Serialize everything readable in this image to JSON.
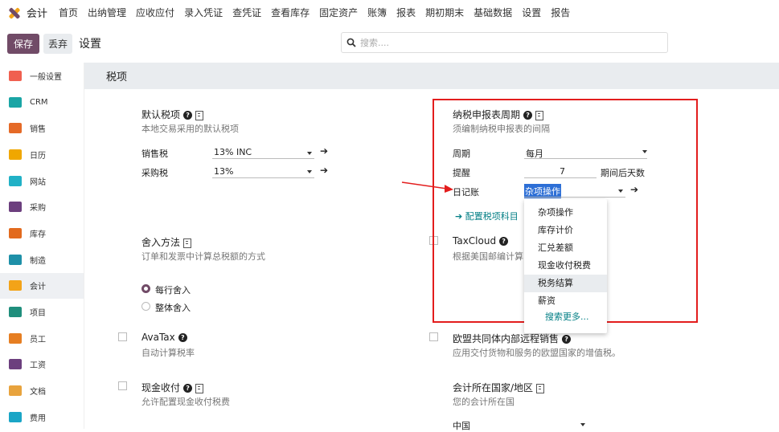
{
  "topnav": {
    "app_name": "会计",
    "menu": [
      "首页",
      "出纳管理",
      "应收应付",
      "录入凭证",
      "查凭证",
      "查看库存",
      "固定资产",
      "账簿",
      "报表",
      "期初期末",
      "基础数据",
      "设置",
      "报告"
    ]
  },
  "controlpanel": {
    "save_label": "保存",
    "discard_label": "丢弃",
    "title": "设置",
    "search_placeholder": "搜索...."
  },
  "sidebar": {
    "items": [
      {
        "label": "一般设置",
        "icon": "general-settings-icon",
        "color": "#f06050"
      },
      {
        "label": "CRM",
        "icon": "crm-icon",
        "color": "#1aa5a5"
      },
      {
        "label": "销售",
        "icon": "sales-icon",
        "color": "#e56a27"
      },
      {
        "label": "日历",
        "icon": "calendar-icon",
        "color": "#f0a700"
      },
      {
        "label": "网站",
        "icon": "website-icon",
        "color": "#21b1c6"
      },
      {
        "label": "采购",
        "icon": "purchase-icon",
        "color": "#6c3f7e"
      },
      {
        "label": "库存",
        "icon": "inventory-icon",
        "color": "#e26a1e"
      },
      {
        "label": "制造",
        "icon": "manufacturing-icon",
        "color": "#1e90a8"
      },
      {
        "label": "会计",
        "icon": "accounting-icon",
        "color": "#f3a318"
      },
      {
        "label": "项目",
        "icon": "project-icon",
        "color": "#1f8e7c"
      },
      {
        "label": "员工",
        "icon": "employees-icon",
        "color": "#e67e22"
      },
      {
        "label": "工资",
        "icon": "payroll-icon",
        "color": "#6c3f7e"
      },
      {
        "label": "文档",
        "icon": "documents-icon",
        "color": "#e8a33d"
      },
      {
        "label": "费用",
        "icon": "expenses-icon",
        "color": "#1aa5c6"
      }
    ]
  },
  "section": {
    "title": "税项"
  },
  "default_taxes": {
    "title": "默认税项",
    "desc": "本地交易采用的默认税项",
    "sales_label": "销售税",
    "sales_value": "13% INC",
    "purchase_label": "采购税",
    "purchase_value": "13%"
  },
  "tax_return": {
    "title": "纳税申报表周期",
    "desc": "须编制纳税申报表的间隔",
    "period_label": "周期",
    "period_value": "每月",
    "reminder_label": "提醒",
    "reminder_value": "7",
    "reminder_suffix": "期间后天数",
    "journal_label": "日记账",
    "journal_value": "杂项操作",
    "config_link": "配置税项科目"
  },
  "rounding": {
    "title": "舍入方法",
    "desc": "订单和发票中计算总税额的方式",
    "options": [
      "每行舍入",
      "整体舍入"
    ]
  },
  "taxcloud": {
    "title": "TaxCloud",
    "desc": "根据美国邮编计算"
  },
  "avatax": {
    "title": "AvaTax",
    "desc": "自动计算税率"
  },
  "eu_oss": {
    "title": "欧盟共同体内部远程销售",
    "desc": "应用交付货物和服务的欧盟国家的增值税。"
  },
  "cash_basis": {
    "title": "现金收付",
    "desc": "允许配置现金收付税费"
  },
  "fiscal_country": {
    "title": "会计所在国家/地区",
    "desc": "您的会计所在国",
    "value": "中国"
  },
  "dropdown": {
    "items": [
      "杂项操作",
      "库存计价",
      "汇兑差额",
      "现金收付税费",
      "税务结算",
      "薪资"
    ],
    "more": "搜索更多..."
  },
  "colors": {
    "brand": "#714b67",
    "link": "#017e84",
    "annotation": "#e31d1d"
  }
}
